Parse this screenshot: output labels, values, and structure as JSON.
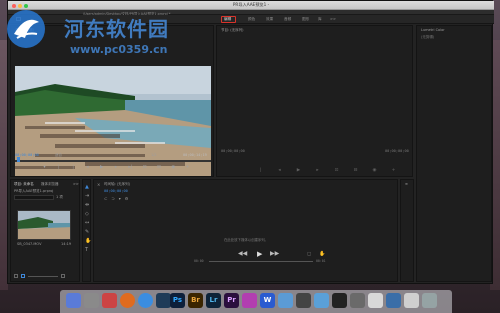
{
  "window": {
    "title": "PR导入AAE预览1 - ",
    "path_text": "/Users/admin/Desktop/文档/PR导入AAE预览1.prproj *"
  },
  "workspaces": [
    "",
    "编辑",
    "颜色",
    "效果",
    "音频",
    "图形",
    "库",
    ">>"
  ],
  "workspace_active_label": "编辑",
  "watermark": {
    "cn": "河东软件园",
    "url": "www.pc0359.cn"
  },
  "source": {
    "tab_label": "源: (无剪辑)",
    "timecode_left": "00;00;00;00",
    "fit_label": "适合",
    "zoom_label": "1/2",
    "timecode_right": "00;00;14;19"
  },
  "program": {
    "tab_label": "节目: (无序列)",
    "timecode_left": "00;00;00;00",
    "timecode_right": "00;00;00;00"
  },
  "lumetri": {
    "title": "Lumetri Color",
    "subtitle": "(无剪辑)"
  },
  "project": {
    "tabs": [
      "项目: 未命名",
      "媒体浏览器",
      ">>"
    ],
    "file_name": "PR导入AAE预览1.prproj",
    "search_placeholder": "",
    "item_count": "1 项",
    "clip_name": "SB_0347.MOV",
    "clip_duration": "14:19"
  },
  "timeline": {
    "tab_label": "时间轴: (无序列)",
    "timecode": "00;00;00;00",
    "empty_message": "在此处放下媒体以创建序列。",
    "time_start": "00:00",
    "time_end": "00:01"
  },
  "dock": {
    "apps": [
      "",
      "",
      "",
      "",
      "",
      "",
      "Ps",
      "Br",
      "Lr",
      "Pr",
      "",
      "W",
      "",
      "",
      "",
      "",
      ""
    ]
  },
  "colors": {
    "accent_blue": "#3f88d8",
    "highlight_red": "#d9342b",
    "panel_bg": "#1e1e1e"
  }
}
